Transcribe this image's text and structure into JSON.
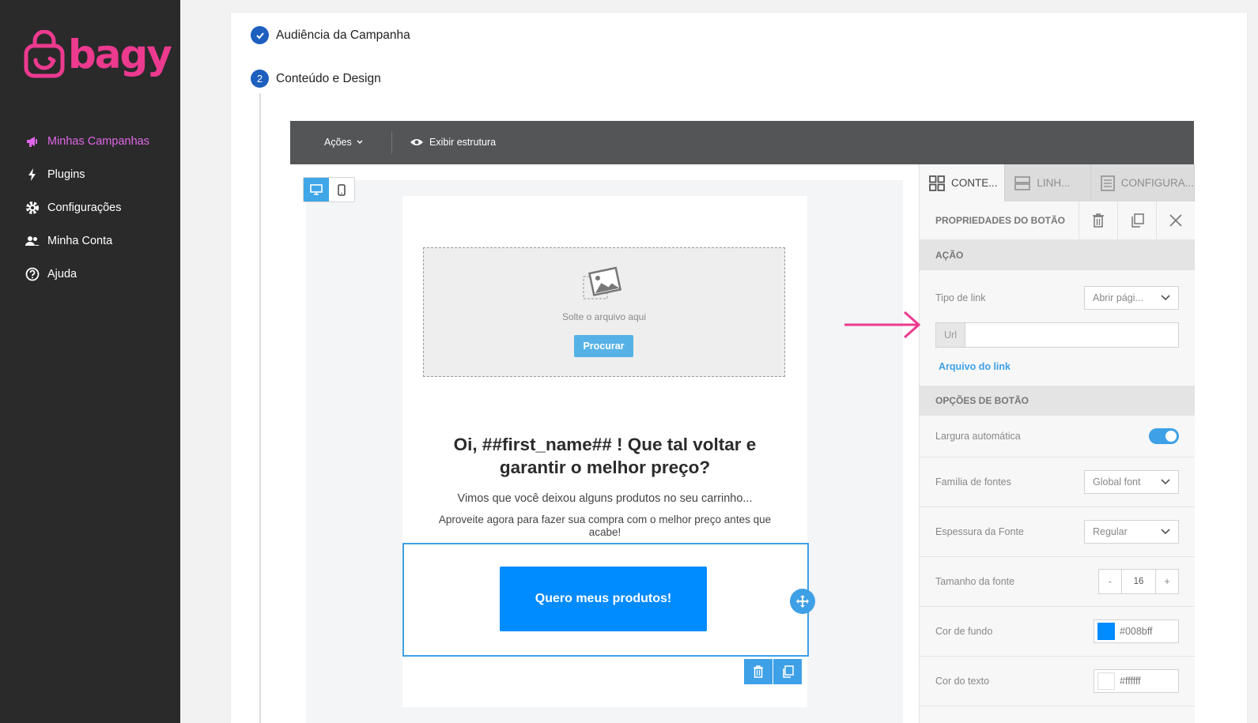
{
  "brand": {
    "name": "bagy",
    "color": "#ec3a8f"
  },
  "sidebar": {
    "items": [
      {
        "label": "Minhas Campanhas",
        "icon": "megaphone-icon",
        "active": true
      },
      {
        "label": "Plugins",
        "icon": "bolt-icon"
      },
      {
        "label": "Configurações",
        "icon": "gear-icon"
      },
      {
        "label": "Minha Conta",
        "icon": "users-icon"
      },
      {
        "label": "Ajuda",
        "icon": "help-icon"
      }
    ]
  },
  "steps": [
    {
      "label": "Audiência da Campanha",
      "status": "done"
    },
    {
      "label": "Conteúdo e Design",
      "number": "2",
      "status": "current"
    }
  ],
  "editor": {
    "toolbar": {
      "actions_label": "Ações",
      "structure_label": "Exibir estrutura"
    },
    "dropzone": {
      "text": "Solte o arquivo aqui",
      "button": "Procurar"
    },
    "heading": "Oi, ##first_name## ! Que tal voltar e garantir o melhor preço?",
    "paragraph1": "Vimos que você deixou alguns produtos no seu carrinho...",
    "paragraph2": "Aproveite agora para fazer sua compra com o melhor preço antes que acabe!",
    "cta_label": "Quero meus produtos!",
    "cta_color": "#008bff"
  },
  "panel": {
    "tabs": [
      "CONTE...",
      "LINH...",
      "CONFIGURA..."
    ],
    "title": "PROPRIEDADES DO BOTÃO",
    "section_action": "AÇÃO",
    "link_type_label": "Tipo de link",
    "link_type_value": "Abrir pági...",
    "url_label": "Url",
    "url_value": "",
    "link_file_label": "Arquivo do link",
    "section_options": "OPÇÕES DE BOTÃO",
    "auto_width_label": "Largura automática",
    "auto_width_on": true,
    "font_family_label": "Família de fontes",
    "font_family_value": "Global font",
    "font_weight_label": "Espessura da Fonte",
    "font_weight_value": "Regular",
    "font_size_label": "Tamanho da fonte",
    "font_size_value": "16",
    "bg_color_label": "Cor de fundo",
    "bg_color_value": "#008bff",
    "text_color_label": "Cor do texto",
    "text_color_value": "#ffffff"
  }
}
